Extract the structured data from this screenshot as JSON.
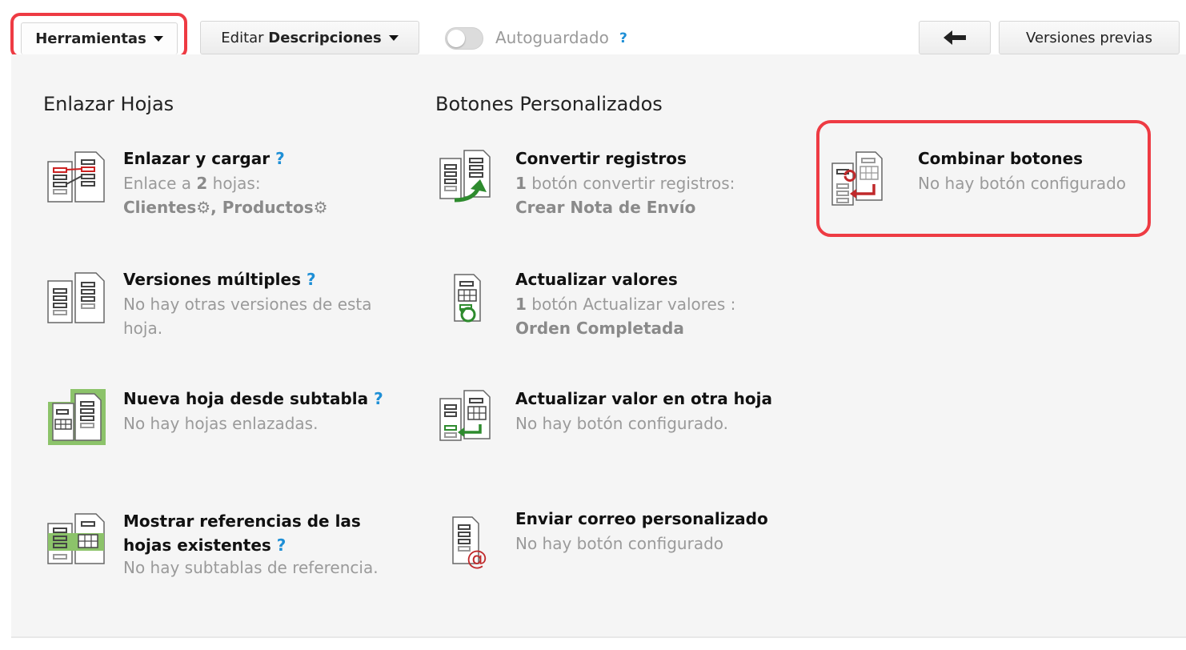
{
  "toolbar": {
    "tools_label": "Herramientas",
    "edit_prefix": "Editar",
    "edit_bold": "Descripciones",
    "autosave_label": "Autoguardado",
    "help_mark": "?",
    "back_icon": "arrow-left-icon",
    "versions_label": "Versiones previas"
  },
  "sections": {
    "link_sheets": "Enlazar Hojas",
    "custom_buttons": "Botones Personalizados"
  },
  "items": {
    "link_load": {
      "title": "Enlazar y cargar",
      "help": "?",
      "line1_pre": "Enlace a ",
      "line1_count": "2",
      "line1_post": " hojas:",
      "sheet1": "Clientes",
      "sep": ", ",
      "sheet2": "Productos"
    },
    "multi_versions": {
      "title": "Versiones múltiples",
      "help": "?",
      "line1": "No hay otras versiones de esta",
      "line2": "hoja."
    },
    "new_sheet_subtable": {
      "title": "Nueva hoja desde subtabla",
      "help": "?",
      "line1": "No hay hojas enlazadas."
    },
    "show_refs": {
      "title_line1": "Mostrar referencias de las",
      "title_line2": "hojas existentes",
      "help": "?",
      "line1": "No hay subtablas de referencia."
    },
    "convert_records": {
      "title": "Convertir registros",
      "count": "1",
      "line1_post": " botón convertir registros:",
      "line2": "Crear Nota de Envío"
    },
    "update_values": {
      "title": "Actualizar valores",
      "count": "1",
      "line1_post": " botón Actualizar valores :",
      "line2": "Orden Completada"
    },
    "update_other": {
      "title": "Actualizar valor en otra hoja",
      "line1": "No hay botón configurado."
    },
    "send_mail": {
      "title": "Enviar correo personalizado",
      "line1": "No hay botón configurado"
    },
    "combine_buttons": {
      "title": "Combinar botones",
      "line1": "No hay botón configurado"
    }
  },
  "colors": {
    "highlight": "#ee3b43",
    "help": "#1e8fd6",
    "green": "#2e8b2e",
    "red_arrow": "#c0292b"
  }
}
